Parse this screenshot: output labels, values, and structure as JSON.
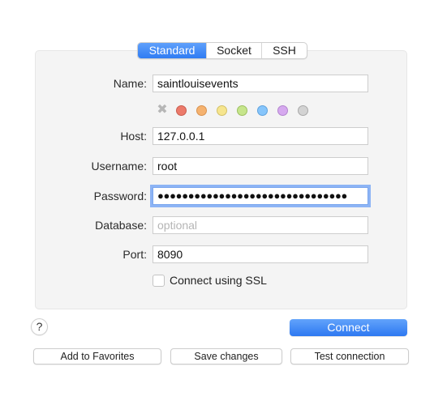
{
  "tabs": [
    {
      "label": "Standard",
      "active": true
    },
    {
      "label": "Socket",
      "active": false
    },
    {
      "label": "SSH",
      "active": false
    }
  ],
  "form": {
    "name": {
      "label": "Name:",
      "value": "saintlouisevents"
    },
    "host": {
      "label": "Host:",
      "value": "127.0.0.1"
    },
    "username": {
      "label": "Username:",
      "value": "root"
    },
    "password": {
      "label": "Password:",
      "value": "●●●●●●●●●●●●●●●●●●●●●●●●●●●●●●●"
    },
    "database": {
      "label": "Database:",
      "value": "",
      "placeholder": "optional"
    },
    "port": {
      "label": "Port:",
      "value": "8090"
    },
    "ssl": {
      "label": "Connect using SSL",
      "checked": false
    }
  },
  "color_tags": {
    "clear_icon": "✖",
    "colors": [
      {
        "name": "red",
        "fill": "#ec7a6a",
        "stroke": "#c95d4f"
      },
      {
        "name": "orange",
        "fill": "#f5b26f",
        "stroke": "#d8924f"
      },
      {
        "name": "yellow",
        "fill": "#f6e58e",
        "stroke": "#d3c168"
      },
      {
        "name": "green",
        "fill": "#c6e58b",
        "stroke": "#9dc062"
      },
      {
        "name": "blue",
        "fill": "#86c5fb",
        "stroke": "#5fa2dd"
      },
      {
        "name": "purple",
        "fill": "#d6a9ef",
        "stroke": "#b385ce"
      },
      {
        "name": "gray",
        "fill": "#d3d3d3",
        "stroke": "#a9a9a9"
      }
    ]
  },
  "buttons": {
    "help": "?",
    "connect": "Connect",
    "add_favorites": "Add to Favorites",
    "save_changes": "Save changes",
    "test_connection": "Test connection"
  }
}
